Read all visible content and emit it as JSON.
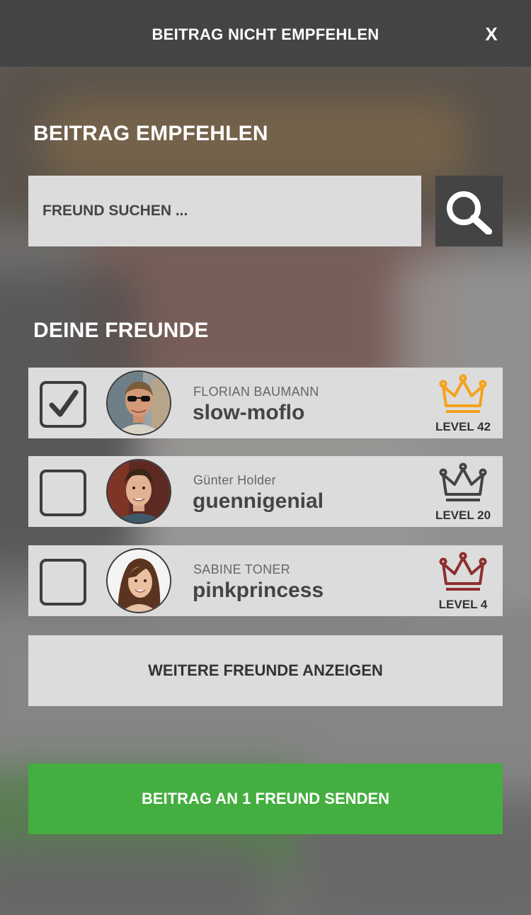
{
  "header": {
    "title": "BEITRAG NICHT EMPFEHLEN",
    "close_label": "X"
  },
  "recommend": {
    "title": "BEITRAG EMPFEHLEN"
  },
  "search": {
    "placeholder": "FREUND SUCHEN ...",
    "value": "",
    "icon": "search-icon"
  },
  "friends": {
    "title": "DEINE FREUNDE",
    "items": [
      {
        "real_name": "FLORIAN BAUMANN",
        "username": "slow-moflo",
        "level": "LEVEL 42",
        "checked": true,
        "crown_color": "#f5a21b"
      },
      {
        "real_name": "Günter Holder",
        "username": "guennigenial",
        "level": "LEVEL 20",
        "checked": false,
        "crown_color": "#444444"
      },
      {
        "real_name": "SABINE TONER",
        "username": "pinkprincess",
        "level": "LEVEL 4",
        "checked": false,
        "crown_color": "#8e2e2e"
      }
    ]
  },
  "more_button": "WEITERE FREUNDE ANZEIGEN",
  "send_button": "BEITRAG AN 1 FREUND SENDEN",
  "colors": {
    "header_bg": "#444444",
    "row_bg": "#dcdcdc",
    "send_bg": "#44ae40"
  }
}
